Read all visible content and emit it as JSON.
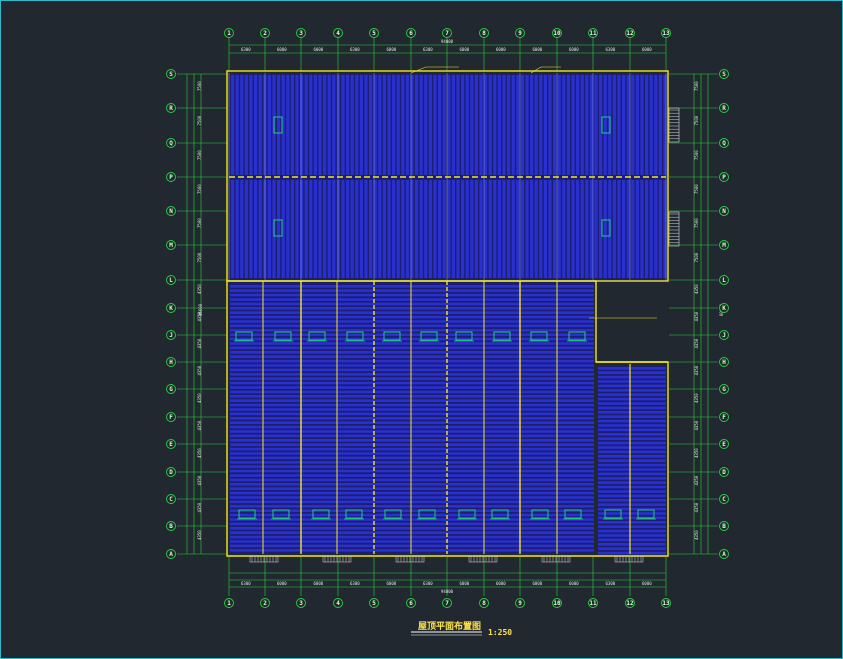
{
  "drawing": {
    "title": "屋顶平面布置图",
    "scale": "1:250",
    "colors": {
      "background": "#212830",
      "frame": "#2fb9c9",
      "grid_lines": "#26d43a",
      "outline": "#f2e52a",
      "panels": "#2a2fd0",
      "panel_dividers": "#9aa3c8",
      "equipment": "#20e070",
      "text": "#e6e6e6",
      "title": "#ffe34d"
    }
  },
  "grid": {
    "columns": [
      "1",
      "2",
      "3",
      "4",
      "5",
      "6",
      "7",
      "8",
      "9",
      "10",
      "11",
      "12",
      "13"
    ],
    "rows_top_down": [
      "S",
      "R",
      "Q",
      "P",
      "N",
      "M",
      "L",
      "K",
      "J",
      "H",
      "G",
      "F",
      "E",
      "D",
      "C",
      "B",
      "A"
    ]
  },
  "dimensions": {
    "top_spans": [
      "6300",
      "6000",
      "6000",
      "6300",
      "6000",
      "6300",
      "6000",
      "6000",
      "6000",
      "6000",
      "6300",
      "6000"
    ],
    "top_total": "94000",
    "bottom_total": "94000",
    "left_total": "86600",
    "right_total": "80000",
    "left_spans": [
      "7500",
      "7500",
      "7500",
      "7500",
      "7500",
      "7500",
      "4350",
      "4350",
      "4350",
      "4350",
      "4350",
      "4350",
      "4350",
      "4350",
      "4350",
      "4350"
    ],
    "right_spans": [
      "7500",
      "7500",
      "7500",
      "7500",
      "7500",
      "7500",
      "4350",
      "4350",
      "4350",
      "4350",
      "4350",
      "4350",
      "4350",
      "4350",
      "4350",
      "4350"
    ]
  }
}
